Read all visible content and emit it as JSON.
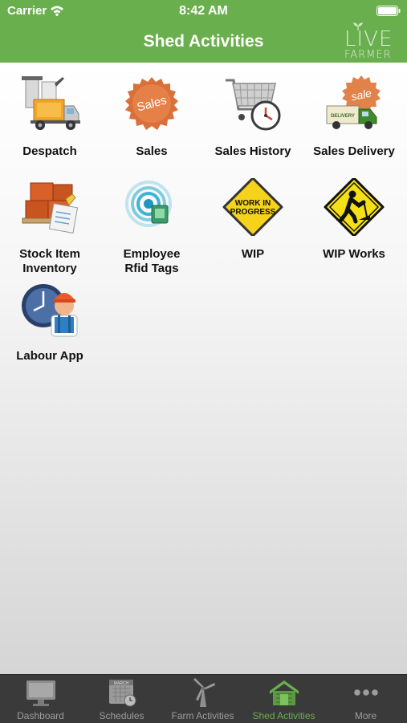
{
  "status_bar": {
    "carrier": "Carrier",
    "time": "8:42 AM"
  },
  "nav": {
    "title": "Shed Activities",
    "logo_top": "LIVE",
    "logo_bottom": "FARMER"
  },
  "tiles": [
    {
      "label": "Despatch",
      "icon": "despatch-truck-icon"
    },
    {
      "label": "Sales",
      "icon": "sales-badge-icon",
      "badge_text": "Sales"
    },
    {
      "label": "Sales History",
      "icon": "cart-clock-icon"
    },
    {
      "label": "Sales Delivery",
      "icon": "delivery-truck-icon",
      "badge_text": "sale",
      "truck_text": "DELIVERY"
    },
    {
      "label": "Stock Item\nInventory",
      "icon": "pallet-boxes-icon"
    },
    {
      "label": "Employee\nRfid Tags",
      "icon": "rfid-tag-icon"
    },
    {
      "label": "WIP",
      "icon": "work-in-progress-sign-icon",
      "sign_line1": "WORK IN",
      "sign_line2": "PROGRESS"
    },
    {
      "label": "WIP Works",
      "icon": "worker-sign-icon"
    },
    {
      "label": "Labour App",
      "icon": "labour-worker-clock-icon"
    }
  ],
  "tabbar": {
    "tabs": [
      {
        "label": "Dashboard",
        "icon": "monitor-icon",
        "active": false
      },
      {
        "label": "Schedules",
        "icon": "calendar-clock-icon",
        "active": false,
        "calendar_text": "MARCH"
      },
      {
        "label": "Farm Activities",
        "icon": "windmill-icon",
        "active": false
      },
      {
        "label": "Shed Activities",
        "icon": "shed-icon",
        "active": true
      },
      {
        "label": "More",
        "icon": "more-dots-icon",
        "active": false
      }
    ]
  },
  "colors": {
    "primary": "#6aaf4d",
    "tabbar_bg": "#3a3a3a",
    "tab_inactive": "#9c9c9c"
  }
}
